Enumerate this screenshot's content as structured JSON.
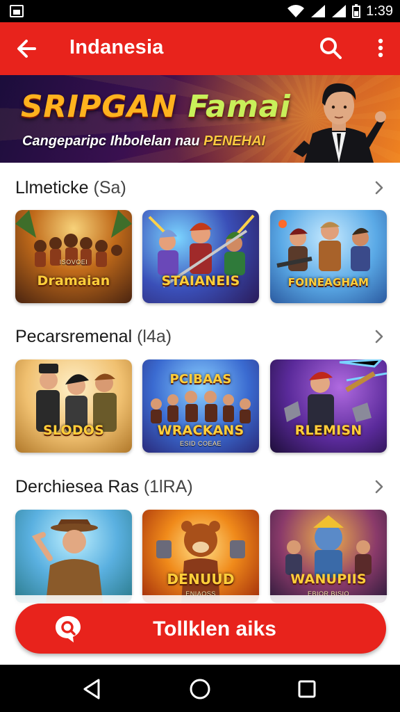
{
  "status_bar": {
    "time": "1:39"
  },
  "app_bar": {
    "title": "Indanesia"
  },
  "banner": {
    "headline_part1": "SRIPGAN",
    "headline_part2": "Famai",
    "subtitle": "Cangeparipc Ihbolelan nau",
    "subtitle_highlight": "PENEHAI"
  },
  "sections": [
    {
      "name": "Llmeticke",
      "count": "(Sa)",
      "games": [
        {
          "title": "Dramaian",
          "subtitle": "ISOVOEI"
        },
        {
          "title": "STAIANEIS",
          "subtitle": ""
        },
        {
          "title": "FOINEAGHAM",
          "subtitle": ""
        }
      ]
    },
    {
      "name": "Pecarsremenal",
      "count": "(l4a)",
      "games": [
        {
          "title": "SLODOS",
          "subtitle": ""
        },
        {
          "title": "WRACKANS",
          "subtitle": "ESID COEAE",
          "top_title": "PCIBAAS"
        },
        {
          "title": "RLEMISN",
          "subtitle": ""
        }
      ]
    },
    {
      "name": "Derchiesea Ras",
      "count": "(1lRA)",
      "games": [
        {
          "title": "",
          "subtitle": ""
        },
        {
          "title": "DENUUD",
          "subtitle": "ENIAOSS"
        },
        {
          "title": "WANUPIIS",
          "subtitle": "EBIOR BISIO"
        }
      ]
    }
  ],
  "cta": {
    "label": "Tollklen aiks"
  },
  "colors": {
    "brand_red": "#e8231c",
    "status_bar": "#000000",
    "nav_bar": "#000000"
  }
}
